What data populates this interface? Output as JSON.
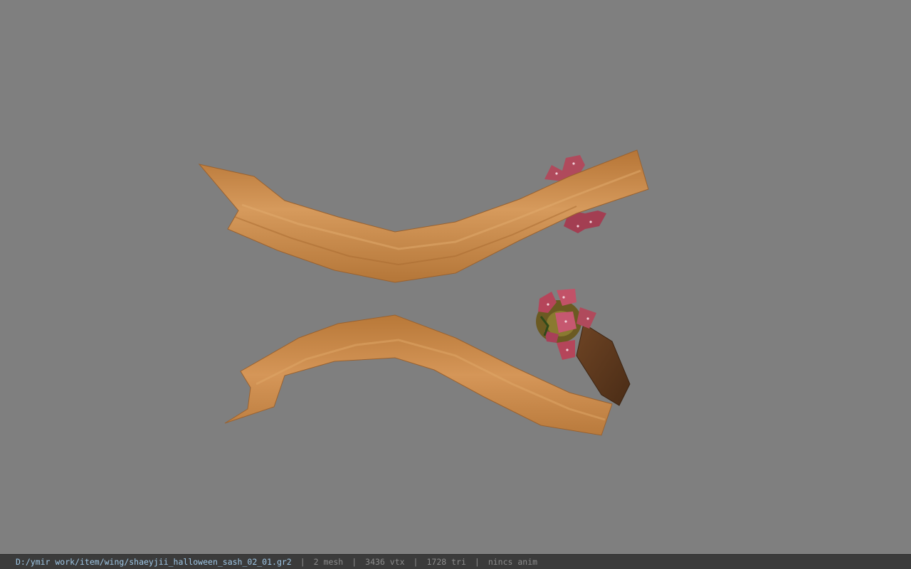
{
  "viewport": {
    "background_color": "#7f7f7f",
    "model": {
      "description_label": "",
      "ribbon_color": "#c88848",
      "ribbon_shadow_color": "#8a5a2e",
      "bow_color": "#b5455a",
      "upper_bow_present": true,
      "lower_bow_present": true
    }
  },
  "status_bar": {
    "file_path": "D:/ymir work/item/wing/shaeyjii_halloween_sash_02_01.gr2",
    "mesh_count": "2 mesh",
    "vertex_count": "3436 vtx",
    "triangle_count": "1728 tri",
    "anim_status": "nincs anim",
    "separator": "|",
    "path_color": "#9fc7e6",
    "text_color": "#8c8c8c",
    "background_color": "#3b3b3b"
  }
}
